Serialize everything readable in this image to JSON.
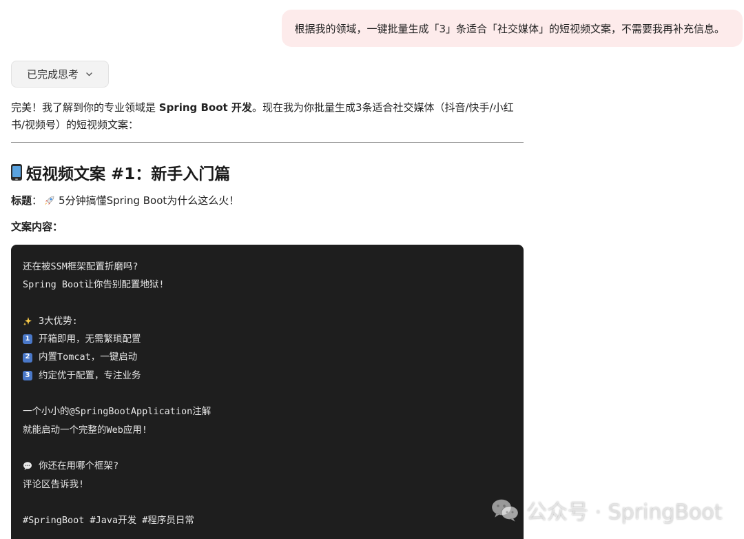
{
  "user_message": {
    "text": "根据我的领域，一键批量生成「3」条适合「社交媒体」的短视频文案，不需要我再补充信息。"
  },
  "thinking": {
    "label": "已完成思考",
    "icon": "chevron-down-icon"
  },
  "reply": {
    "intro_prefix": "完美！我了解到你的专业领域是 ",
    "intro_bold": "Spring Boot 开发",
    "intro_suffix": "。现在我为你批量生成3条适合社交媒体（抖音/快手/小红书/视频号）的短视频文案：",
    "heading": "短视频文案 #1：新手入门篇",
    "heading_icon": "mobile-phone-icon",
    "title_label": "标题",
    "title_sep": "：",
    "title_icon": "rocket-icon",
    "title_text": "5分钟搞懂Spring Boot为什么这么火！",
    "content_label": "文案内容",
    "content_sep": "："
  },
  "code_block": {
    "lines": [
      "还在被SSM框架配置折磨吗?",
      "Spring Boot让你告别配置地狱!",
      "",
      "3大优势:",
      "开箱即用，无需繁琐配置",
      "内置Tomcat，一键启动",
      "约定优于配置，专注业务",
      "",
      "一个小小的@SpringBootApplication注解",
      "就能启动一个完整的Web应用!",
      "",
      "你还在用哪个框架?",
      "评论区告诉我!",
      "",
      "#SpringBoot #Java开发 #程序员日常"
    ],
    "badges": [
      "1",
      "2",
      "3"
    ],
    "icons": [
      "sparkles-icon",
      "speech-bubble-icon"
    ]
  },
  "watermark": {
    "text": "公众号 · SpringBoot",
    "icon": "wechat-icon"
  },
  "colors": {
    "user_bubble_bg": "#fdebeb",
    "code_bg": "#1e1e1e",
    "badge_blue": "#4a78c8"
  }
}
